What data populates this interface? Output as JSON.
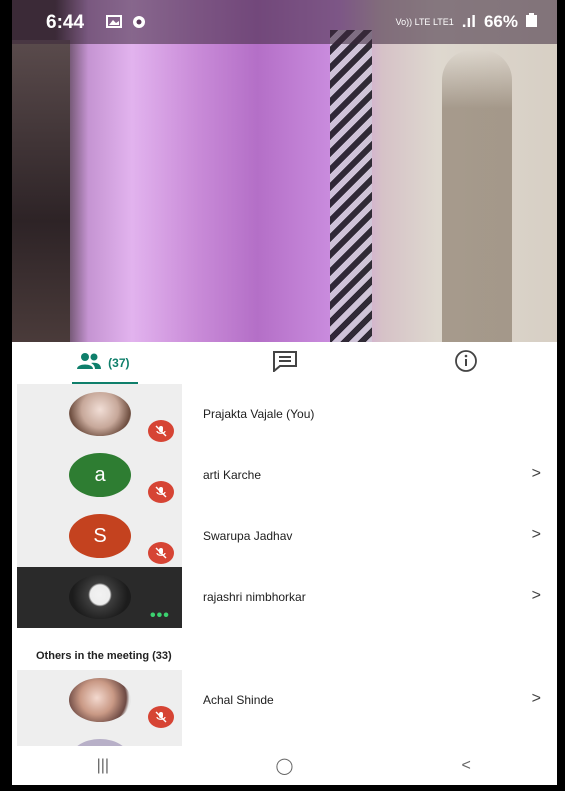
{
  "status_bar": {
    "time": "6:44",
    "network": "Vo)) LTE LTE1",
    "signal": ".ıl",
    "battery": "66%"
  },
  "tabs": [
    {
      "icon": "people-icon",
      "count": "(37)",
      "active": true
    },
    {
      "icon": "chat-icon",
      "active": false
    },
    {
      "icon": "info-icon",
      "active": false
    }
  ],
  "participants": [
    {
      "name": "Prajakta Vajale (You)",
      "avatar_type": "photo",
      "mic": "muted",
      "chevron": false
    },
    {
      "name": "arti Karche",
      "avatar_letter": "a",
      "avatar_color": "#2e7d32",
      "mic": "muted",
      "chevron": true,
      "chevron_label": ">"
    },
    {
      "name": "Swarupa Jadhav",
      "avatar_letter": "S",
      "avatar_color": "#c4421f",
      "mic": "muted",
      "chevron": true,
      "chevron_label": ">"
    },
    {
      "name": "rajashri nimbhorkar",
      "avatar_type": "photo",
      "mic": "speaking",
      "chevron": true,
      "chevron_label": ">"
    }
  ],
  "others_section": {
    "title": "Others in the meeting (33)"
  },
  "others": [
    {
      "name": "Achal Shinde",
      "avatar_type": "photo",
      "mic": "muted",
      "chevron": true,
      "chevron_label": ">"
    }
  ],
  "navbar": {
    "recents": "|||",
    "home": "◯",
    "back": "<"
  },
  "colors": {
    "accent": "#0f7f6b",
    "mute_red": "#d64434"
  }
}
